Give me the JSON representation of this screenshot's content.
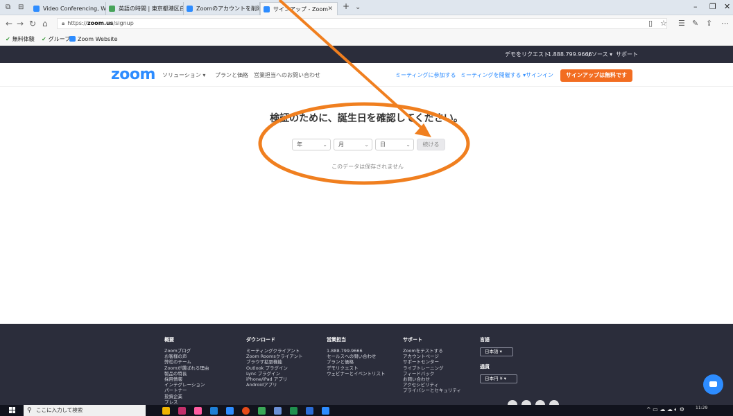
{
  "browser": {
    "tabs": [
      {
        "label": "Video Conferencing, Web C"
      },
      {
        "label": "英語の時間 | 東京都港区白"
      },
      {
        "label": "Zoomのアカウントを削除する方"
      },
      {
        "label": "サインアップ - Zoom"
      }
    ],
    "url_prefix": "https://",
    "url_host": "zoom.us",
    "url_path": "/signup",
    "bookmarks": [
      {
        "label": "無料体験"
      },
      {
        "label": "グループ"
      },
      {
        "label": "Zoom Website"
      }
    ]
  },
  "topbar": {
    "request_demo": "デモをリクエスト",
    "phone": "1.888.799.9666",
    "resources": "リソース",
    "support": "サポート"
  },
  "nav": {
    "logo": "zoom",
    "solutions": "ソリューション",
    "plans": "プランと価格",
    "contact_sales": "営業担当へのお問い合わせ",
    "join_meeting": "ミーティングに参加する",
    "host_meeting": "ミーティングを開催する",
    "sign_in": "サインイン",
    "signup_free": "サインアップは無料です"
  },
  "main": {
    "title": "検証のために、誕生日を確認してください。",
    "year_placeholder": "年",
    "month_placeholder": "月",
    "day_placeholder": "日",
    "continue_label": "続ける",
    "note": "このデータは保存されません"
  },
  "footer": {
    "columns": [
      {
        "heading": "概要",
        "items": [
          "Zoomブログ",
          "お客様の声",
          "弊社のチーム",
          "Zoomが選ばれる理由",
          "製品の特長",
          "採用情報",
          "インテグレーション",
          "パートナー",
          "投資企業",
          "プレス"
        ]
      },
      {
        "heading": "ダウンロード",
        "items": [
          "ミーティングクライアント",
          "Zoom Roomsクライアント",
          "ブラウザ拡張機能",
          "Outlook プラグイン",
          "Lync プラグイン",
          "iPhone/iPad アプリ",
          "Androidアプリ"
        ]
      },
      {
        "heading": "営業担当",
        "items": [
          "1.888.799.9666",
          "セールスへの問い合わせ",
          "プランと価格",
          "デモリクエスト",
          "ウェビナーとイベントリスト"
        ]
      },
      {
        "heading": "サポート",
        "items": [
          "Zoomをテストする",
          "アカウントページ",
          "サポートセンター",
          "ライブトレーニング",
          "フィードバック",
          "お問い合わせ",
          "アクセシビリティ",
          "プライバシーとセキュリティ"
        ]
      }
    ],
    "language_heading": "言語",
    "language_value": "日本語",
    "currency_heading": "通貨",
    "currency_value": "日本円 ¥"
  },
  "taskbar": {
    "search_placeholder": "ここに入力して検索",
    "time": "11:29"
  },
  "annotation": {
    "color": "#f07f1f"
  }
}
